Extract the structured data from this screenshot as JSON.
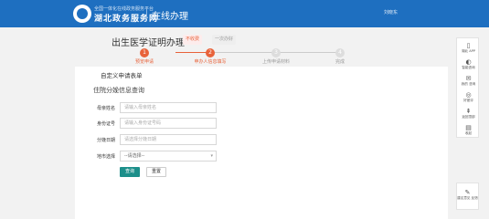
{
  "header": {
    "brand_sub": "全国一体化在线政务服务平台",
    "brand_main": "湖北政务服务网",
    "title": "在线办理",
    "user": "刘晓东"
  },
  "page": {
    "title": "出生医学证明办理",
    "fee_badge": "不收费",
    "visit_badge": "一次办好"
  },
  "steps": [
    {
      "num": "1",
      "label": "预览申请",
      "active": true
    },
    {
      "num": "2",
      "label": "申办人信息填写",
      "active": true
    },
    {
      "num": "3",
      "label": "上传申请材料",
      "active": false
    },
    {
      "num": "4",
      "label": "完成",
      "active": false
    }
  ],
  "form": {
    "section_title": "自定义申请表单",
    "sub_title": "住院分娩信息查询",
    "fields": [
      {
        "label": "母亲姓名",
        "placeholder": "请输入母亲姓名"
      },
      {
        "label": "身份证号",
        "placeholder": "请输入身份证号码"
      },
      {
        "label": "分娩日期",
        "placeholder": "请选择分娩日期"
      }
    ],
    "city": {
      "label": "地市选择",
      "value": "--请选择--"
    },
    "query_label": "查询",
    "reset_label": "重置"
  },
  "side_panel": {
    "items": [
      {
        "icon": "▯",
        "label": "湖北 APP",
        "icon_name": "phone-icon"
      },
      {
        "icon": "◐",
        "label": "智能咨询",
        "icon_name": "chat-icon"
      },
      {
        "icon": "✉",
        "label": "我的 咨询",
        "icon_name": "message-icon"
      },
      {
        "icon": "◎",
        "label": "好差评",
        "icon_name": "rating-icon"
      },
      {
        "icon": "⇞",
        "label": "返回顶部",
        "icon_name": "top-icon"
      },
      {
        "icon": "▤",
        "label": "收起",
        "icon_name": "collapse-icon"
      }
    ],
    "bottom": {
      "icon": "✎",
      "label": "建议意见 反馈",
      "icon_name": "feedback-icon"
    }
  },
  "colors": {
    "header_bg": "#1e6fc0",
    "accent": "#e8623a",
    "query_button": "#1c8f8a"
  }
}
